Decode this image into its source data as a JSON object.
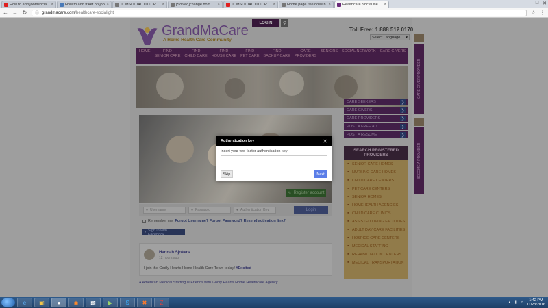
{
  "browser": {
    "tabs": [
      {
        "title": "How to add joomsocial",
        "favicon": "youtube-icon",
        "color": "#e02020"
      },
      {
        "title": "How to add triket on joo",
        "favicon": "globe-icon",
        "color": "#4a7ab8"
      },
      {
        "title": "JOMSOCIAL TUTORIAL",
        "favicon": "page-icon",
        "color": "#777777"
      },
      {
        "title": "[Solved]change homepo",
        "favicon": "page-icon",
        "color": "#777777"
      },
      {
        "title": "JOMSOCIAL TUTORIAL",
        "favicon": "youtube-icon",
        "color": "#e02020"
      },
      {
        "title": "Home page title does n",
        "favicon": "page-icon",
        "color": "#777777"
      },
      {
        "title": "Healthcare Social Netwo",
        "favicon": "grandmacare-icon",
        "color": "#6a2a7a",
        "active": true
      }
    ],
    "url_host": "grandmacare.com",
    "url_path": "/healthcare-socialight"
  },
  "site": {
    "login_label": "LOGIN",
    "logo_name": "GrandMaCare",
    "logo_tagline": "A Home Health Care Community",
    "toll_free": "Toll Free: 1 888 512 0170",
    "language_select": "Select Language",
    "nav": [
      {
        "line1": "HOME",
        "line2": ""
      },
      {
        "line1": "FIND",
        "line2": "SENIOR CARE"
      },
      {
        "line1": "FIND",
        "line2": "CHILD CARE"
      },
      {
        "line1": "FIND",
        "line2": "HOUSE CARE"
      },
      {
        "line1": "FIND",
        "line2": "PET CARE"
      },
      {
        "line1": "FIND",
        "line2": "BACKUP CARE"
      },
      {
        "line1": "CARE",
        "line2": "PROVIDERS"
      },
      {
        "line1": "SENIORS",
        "line2": ""
      },
      {
        "line1": "SOCIAL NETWORK",
        "line2": ""
      },
      {
        "line1": "CARE GIVERS",
        "line2": ""
      }
    ],
    "side_links": [
      "CARE SEEKERS",
      "CARE GIVERS",
      "CARE PROVIDERS",
      "POST A FREE AD",
      "POST A RESUME"
    ],
    "providers_header": "SEARCH REGISTERED PROVIDERS",
    "providers": [
      "SENIOR CARE HOMES",
      "NURSING CARE HOMES",
      "CHILD CARE CENTERS",
      "PET CARE CENTERS",
      "SENIOR HOMES",
      "HOMEHEALTH AGENCIES",
      "CHILD CARE CLINICS",
      "ASSISTED LIVING FACILITIES",
      "ADULT DAY CARE FACILITIES",
      "HOSPICE CARE CENTERS",
      "MEDICAL STAFFING",
      "REHABILITATION CENTERS",
      "MEDICAL TRANSPORTATION"
    ],
    "vertical_tab_1": "CARE GIVER PROVIDER",
    "vertical_tab_2": "BECOME A PROVIDER",
    "register_button": "Register account",
    "username_placeholder": "Username",
    "password_placeholder": "Password",
    "auth_key_placeholder": "Authentication Key",
    "login_button": "Login",
    "remember_me": "Remember me",
    "forgot_links": "Forgot Username? Forgot Password? Resend activation link?",
    "facebook_button": "Sign in with Facebook",
    "post": {
      "author": "Hannah Sjokers",
      "time": "12 hours ago",
      "body": "I join the Godly Hearts Home Health Care Team today!",
      "hashtag": "#Excited"
    },
    "activity_line": "American Medical Staffing is Friends with Godly Hearts Home Healthcare Agency"
  },
  "modal": {
    "title": "Authentication key",
    "label": "Insert your two-factor authentication key",
    "input_value": "",
    "skip_label": "Skip",
    "next_label": "Next"
  },
  "taskbar": {
    "time": "1:42 PM",
    "date": "11/23/2016"
  }
}
